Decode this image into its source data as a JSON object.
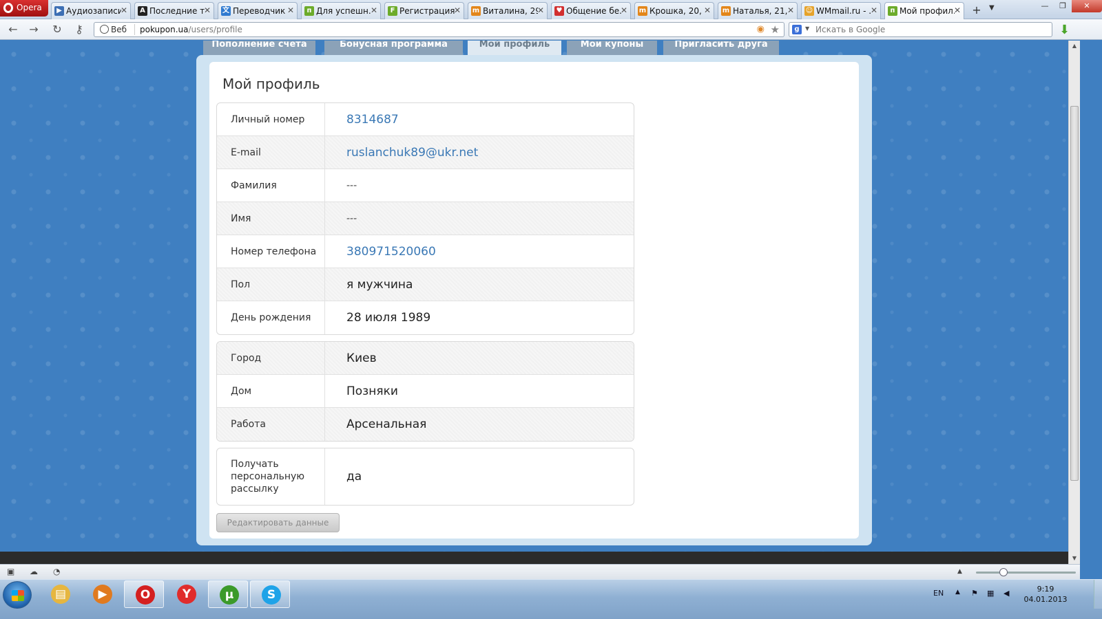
{
  "browser": {
    "menu_label": "Opera",
    "tabs": [
      {
        "title": "Аудиозаписи...",
        "fav": "play-icon",
        "color": "#3d6fb4",
        "glyph": "▶"
      },
      {
        "title": "Последние т...",
        "fav": "letter-a-icon",
        "color": "#222222",
        "glyph": "A"
      },
      {
        "title": "Переводчик ...",
        "fav": "translate-icon",
        "color": "#2f7ad0",
        "glyph": "文"
      },
      {
        "title": "Для успешн...",
        "fav": "pokupon-icon",
        "color": "#6cab2a",
        "glyph": "п"
      },
      {
        "title": "Регистрация ...",
        "fav": "letter-f-icon",
        "color": "#6cab2a",
        "glyph": "F"
      },
      {
        "title": "Виталина, 29,...",
        "fav": "mamba-icon",
        "color": "#e3861a",
        "glyph": "m"
      },
      {
        "title": "Общение бе...",
        "fav": "heart-icon",
        "color": "#d22f2f",
        "glyph": "♥"
      },
      {
        "title": "Крошка, 20, ...",
        "fav": "mamba-icon",
        "color": "#e3861a",
        "glyph": "m"
      },
      {
        "title": "Наталья, 21, ...",
        "fav": "mamba-icon",
        "color": "#e3861a",
        "glyph": "m"
      },
      {
        "title": "WMmail.ru - ...",
        "fav": "wmmail-icon",
        "color": "#e6a32a",
        "glyph": "☺"
      },
      {
        "title": "Мой профил...",
        "fav": "pokupon-icon",
        "color": "#6cab2a",
        "glyph": "п",
        "active": true
      }
    ],
    "address": {
      "badge": "Веб",
      "host": "pokupon.ua",
      "path": "/users/profile"
    },
    "search_placeholder": "Искать в Google"
  },
  "site": {
    "tabs": [
      {
        "label": "Пополнение счета"
      },
      {
        "label": "Бонусная программа"
      },
      {
        "label": "Мой профиль",
        "active": true
      },
      {
        "label": "Мои купоны"
      },
      {
        "label": "Пригласить друга"
      }
    ],
    "title": "Мой профиль",
    "group1": [
      {
        "label": "Личный номер",
        "value": "8314687",
        "type": "link"
      },
      {
        "label": "E-mail",
        "value": "ruslanchuk89@ukr.net",
        "type": "link"
      },
      {
        "label": "Фамилия",
        "value": "---",
        "type": "dash"
      },
      {
        "label": "Имя",
        "value": "---",
        "type": "dash"
      },
      {
        "label": "Номер телефона",
        "value": "380971520060",
        "type": "link"
      },
      {
        "label": "Пол",
        "value": "я мужчина",
        "type": "text"
      },
      {
        "label": "День рождения",
        "value": "28 июля 1989",
        "type": "text"
      }
    ],
    "group2": [
      {
        "label": "Город",
        "value": "Киев",
        "type": "text"
      },
      {
        "label": "Дом",
        "value": "Позняки",
        "type": "text"
      },
      {
        "label": "Работа",
        "value": "Арсенальная",
        "type": "text"
      }
    ],
    "group3": [
      {
        "label": "Получать персональную рассылку",
        "value": "да",
        "type": "text"
      }
    ],
    "edit_button": "Редактировать данные"
  },
  "taskbar": {
    "apps": [
      {
        "name": "explorer-taskbar-icon",
        "glyph": "▤",
        "color": "#e6b640",
        "on": false
      },
      {
        "name": "media-player-taskbar-icon",
        "glyph": "▶",
        "color": "#e07a1f",
        "on": false
      },
      {
        "name": "opera-taskbar-icon",
        "glyph": "O",
        "color": "#d42020",
        "on": true
      },
      {
        "name": "yandex-taskbar-icon",
        "glyph": "Y",
        "color": "#e02c2c",
        "on": false
      },
      {
        "name": "utorrent-taskbar-icon",
        "glyph": "µ",
        "color": "#3b9a2a",
        "on": true
      },
      {
        "name": "skype-taskbar-icon",
        "glyph": "S",
        "color": "#1fa3e8",
        "on": true
      }
    ],
    "lang": "EN",
    "time": "9:19",
    "date": "04.01.2013"
  }
}
